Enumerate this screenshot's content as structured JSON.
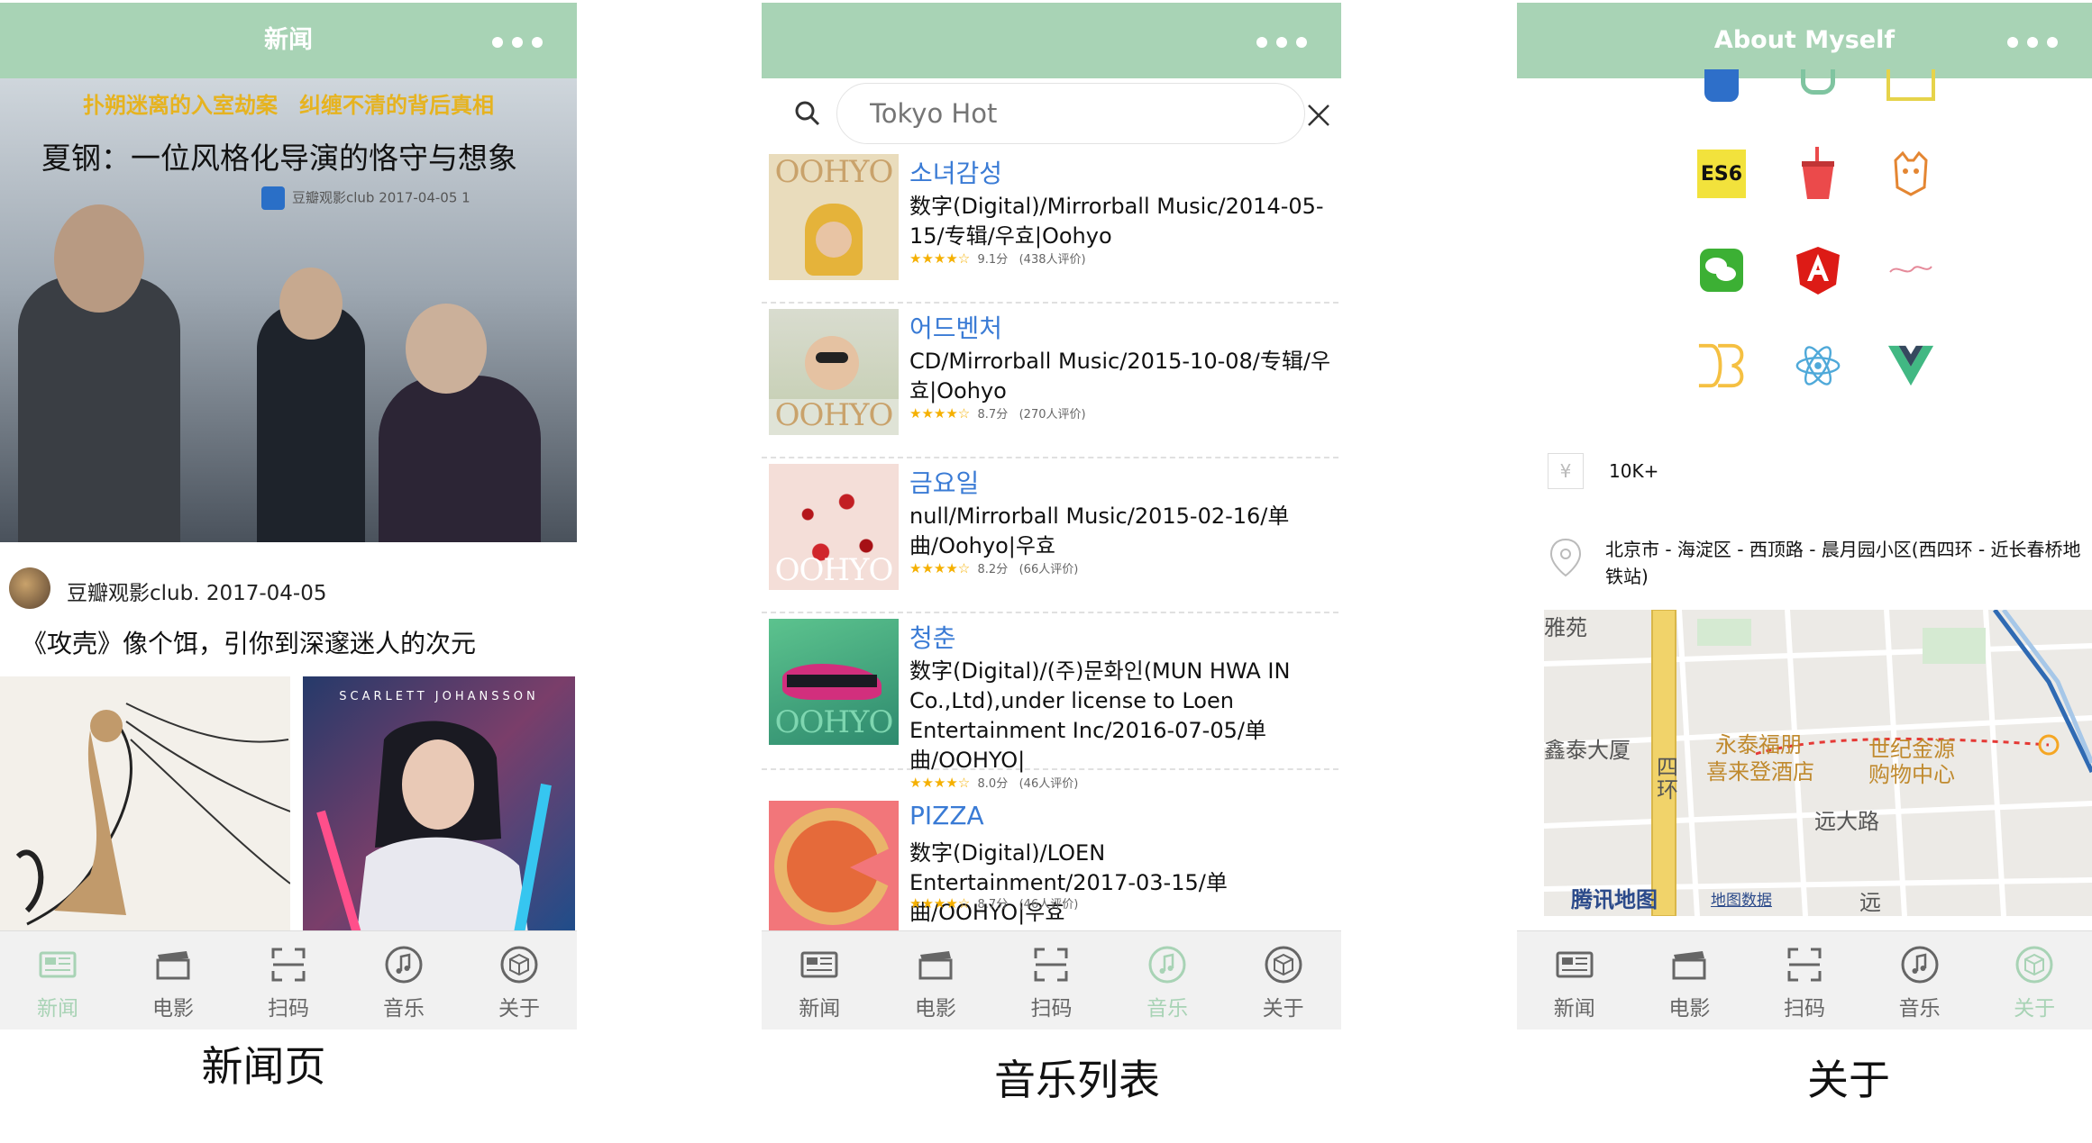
{
  "screens": [
    {
      "nav_title": "新闻",
      "caption": "新闻页",
      "hero": {
        "tagline": "扑朔迷离的入室劫案　纠缠不清的背后真相",
        "headline": "夏钢：一位风格化导演的恪守与想象",
        "source": "豆瓣观影club 2017-04-05 1"
      },
      "post": {
        "author_meta": "豆瓣观影club. 2017-04-05",
        "title": "《攻壳》像个饵，引你到深邃迷人的次元"
      },
      "poster2_title": "SCARLETT JOHANSSON"
    },
    {
      "nav_title": "",
      "caption": "音乐列表",
      "search": {
        "placeholder": "Tokyo Hot"
      },
      "songs": [
        {
          "name": "소녀감성",
          "desc": "数字(Digital)/Mirrorball Music/2014-05-15/专辑/우효|Oohyo",
          "score": "9.1分",
          "count": "(438人评价)",
          "logo": "OOHYO",
          "stars": 4.5
        },
        {
          "name": "어드벤처",
          "desc": "CD/Mirrorball Music/2015-10-08/专辑/우효|Oohyo",
          "score": "8.7分",
          "count": "(270人评价)",
          "logo": "OOHYO",
          "stars": 4.5
        },
        {
          "name": "금요일",
          "desc": "null/Mirrorball Music/2015-02-16/单曲/Oohyo|우효",
          "score": "8.2分",
          "count": "(66人评价)",
          "logo": "OOHYO",
          "stars": 4
        },
        {
          "name": "청춘",
          "desc": "数字(Digital)/(주)문화인(MUN HWA IN Co.,Ltd),under license to Loen Entertainment Inc/2016-07-05/单曲/OOHYO|",
          "score": "8.0分",
          "count": "(46人评价)",
          "logo": "OOHYO",
          "stars": 4
        },
        {
          "name": "PIZZA",
          "desc": "数字(Digital)/LOEN Entertainment/2017-03-15/单曲/OOHYO|우효",
          "score": "8.7分",
          "count": "(46人评价)",
          "logo": "",
          "stars": 4.5
        }
      ]
    },
    {
      "nav_title": "About Myself",
      "caption": "关于",
      "skills": [
        "ES6"
      ],
      "salary": "10K+",
      "address": "北京市 - 海淀区 - 西顶路 - 晨月园小区(西四环 - 近长春桥地铁站)",
      "map": {
        "labels": [
          "雅苑",
          "鑫泰大厦",
          "永泰福朋",
          "喜来登酒店",
          "世纪金源",
          "购物中心",
          "远大路",
          "四",
          "环",
          "远"
        ],
        "brand": "腾讯地图",
        "data_link": "地图数据"
      }
    }
  ],
  "tabs": [
    "新闻",
    "电影",
    "扫码",
    "音乐",
    "关于"
  ],
  "colors": {
    "accent": "#a8d3b5",
    "link": "#3a7bd5",
    "star": "#f5b000"
  }
}
